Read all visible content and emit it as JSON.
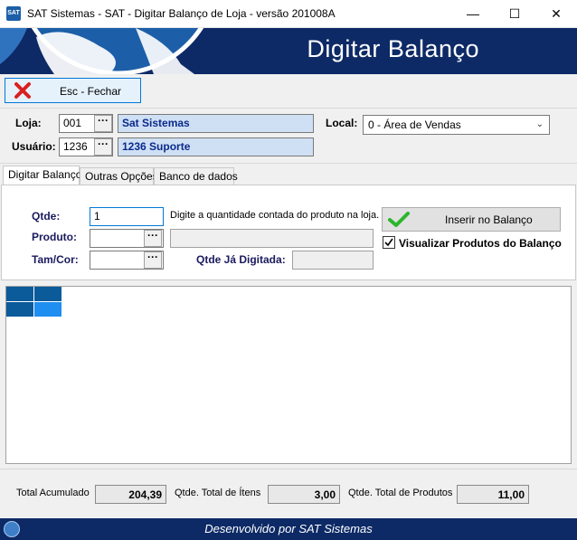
{
  "window": {
    "title": "SAT Sistemas - SAT - Digitar Balanço de Loja - versão 201008A",
    "app_icon_text": "SAT",
    "minimize": "—",
    "maximize": "☐",
    "close": "✕"
  },
  "banner": {
    "title": "Digitar Balanço"
  },
  "toolbar": {
    "close_label": "Esc - Fechar"
  },
  "header": {
    "loja_label": "Loja:",
    "loja_code": "001",
    "loja_name": "Sat Sistemas",
    "usuario_label": "Usuário:",
    "usuario_code": "1236",
    "usuario_name": "1236 Suporte",
    "local_label": "Local:",
    "local_value": "0 - Área de Vendas",
    "ellipsis": "···"
  },
  "tabs": [
    {
      "label": "Digitar Balanço",
      "active": true
    },
    {
      "label": "Outras Opções",
      "active": false
    },
    {
      "label": "Banco de dados",
      "active": false
    }
  ],
  "panel": {
    "qtde_label": "Qtde:",
    "qtde_value": "1",
    "qtde_hint": "Digite a quantidade contada do produto na loja.",
    "produto_label": "Produto:",
    "produto_value": "",
    "tamcor_label": "Tam/Cor:",
    "tamcor_value": "",
    "qtde_ja_label": "Qtde Já Digitada:",
    "insert_label": "Inserir no Balanço",
    "visualizar_label": "Visualizar Produtos do Balanço",
    "visualizar_checked": true
  },
  "totals": {
    "acumulado_label": "Total Acumulado",
    "acumulado_value": "204,39",
    "itens_label": "Qtde. Total de Ítens",
    "itens_value": "3,00",
    "produtos_label": "Qtde. Total de Produtos",
    "produtos_value": "11,00"
  },
  "footer": {
    "text": "Desenvolvido por SAT Sistemas"
  },
  "colors": {
    "banner_bg": "#0d2a66",
    "accent_blue": "#0078d7",
    "field_blue": "#cfe0f5",
    "check_green": "#2db52d",
    "close_red": "#d92020"
  }
}
